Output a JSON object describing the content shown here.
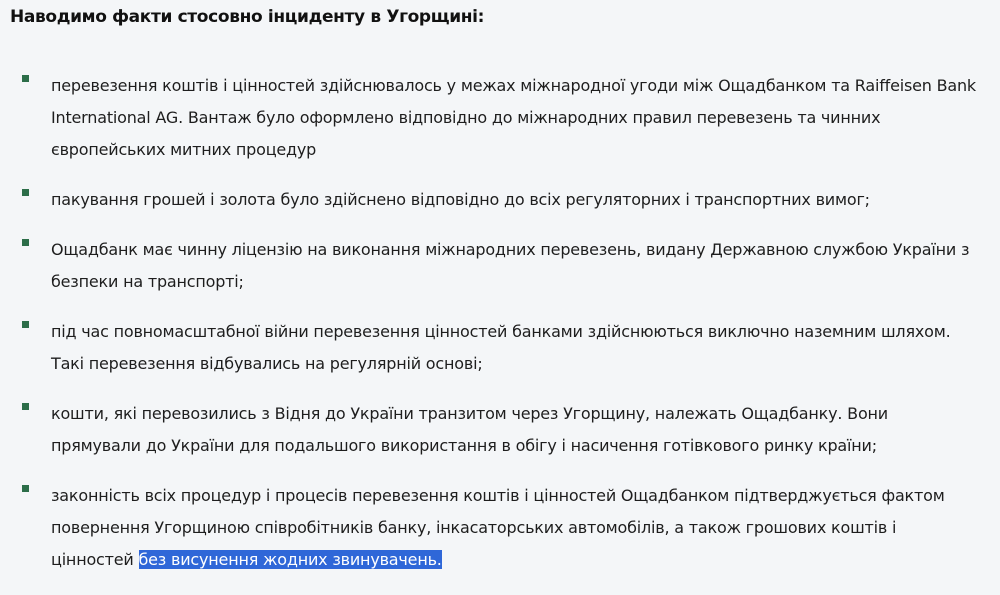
{
  "heading": "Наводимо факти стосовно інциденту в Угорщині:",
  "items": [
    {
      "text": "перевезення коштів і цінностей здійснювалось у межах міжнародної угоди між Ощадбанком та Raiffeisen Bank International AG. Вантаж було оформлено відповідно до міжнародних правил перевезень та чинних європейських митних процедур"
    },
    {
      "text": "пакування грошей і золота було здійснено відповідно до всіх регуляторних і транспортних вимог;"
    },
    {
      "text": "Ощадбанк має чинну ліцензію на виконання міжнародних перевезень, видану Державною службою України з безпеки на транспорті;"
    },
    {
      "text": "під час повномасштабної війни перевезення цінностей банками здійснюються виключно наземним шляхом. Такі перевезення відбувались на регулярній основі;"
    },
    {
      "text": "кошти, які перевозились з Відня до України транзитом через Угорщину, належать Ощадбанку. Вони прямували до України для подальшого використання в обігу і насичення готівкового ринку країни;"
    },
    {
      "text": "законність всіх процедур і процесів перевезення коштів і цінностей Ощадбанком підтверджується фактом повернення Угорщиною співробітників банку, інкасаторських автомобілів,  а також грошових коштів і цінностей ",
      "selected": "без висунення жодних звинувачень."
    }
  ],
  "colors": {
    "background": "#f4f6f8",
    "bullet": "#2c6e49",
    "selection": "#2f67d8"
  }
}
